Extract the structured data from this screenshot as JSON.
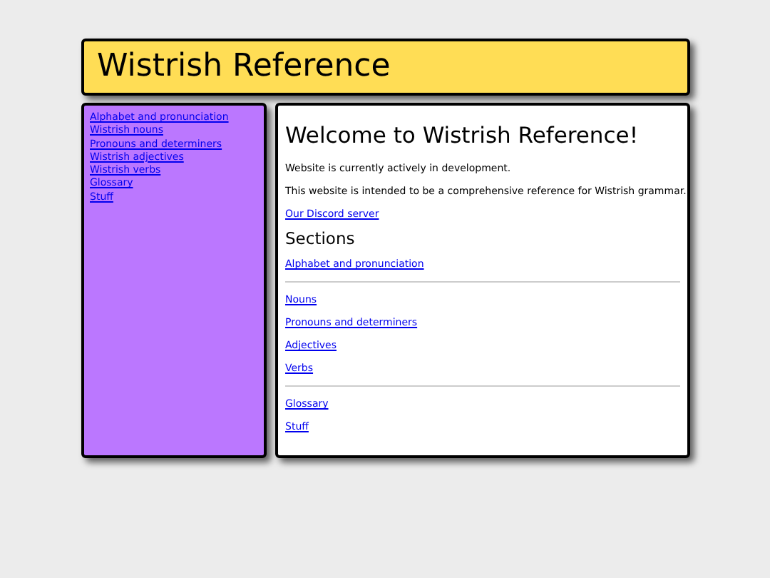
{
  "header": {
    "title": "Wistrish Reference"
  },
  "sidebar": {
    "links": [
      "Alphabet and pronunciation",
      "Wistrish nouns",
      "Pronouns and determiners",
      "Wistrish adjectives",
      "Wistrish verbs",
      "Glossary",
      "Stuff"
    ]
  },
  "main": {
    "heading": "Welcome to Wistrish Reference!",
    "paragraphs": [
      "Website is currently actively in development.",
      "This website is intended to be a comprehensive reference for Wistrish grammar."
    ],
    "discord_link": "Our Discord server",
    "sections_heading": "Sections",
    "section_groups": [
      [
        "Alphabet and pronunciation"
      ],
      [
        "Nouns",
        "Pronouns and determiners",
        "Adjectives",
        "Verbs"
      ],
      [
        "Glossary",
        "Stuff"
      ]
    ]
  }
}
